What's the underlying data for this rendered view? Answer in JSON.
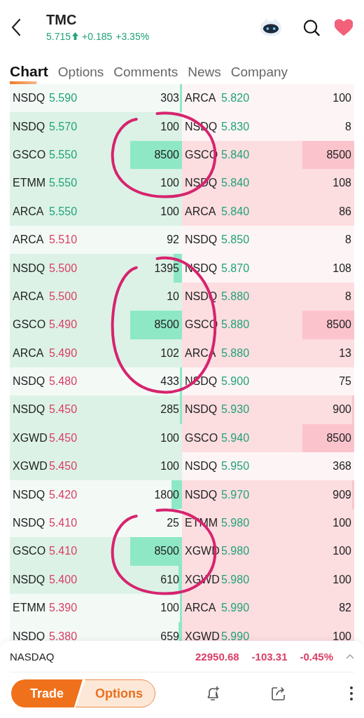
{
  "header": {
    "symbol": "TMC",
    "price": "5.715",
    "change": "+0.185",
    "percent": "+3.35%",
    "up": true,
    "favorite": true
  },
  "tabs": [
    {
      "label": "Chart",
      "selected": true
    },
    {
      "label": "Options",
      "selected": false
    },
    {
      "label": "Comments",
      "selected": false
    },
    {
      "label": "News",
      "selected": false
    },
    {
      "label": "Company",
      "selected": false
    }
  ],
  "order_book": {
    "rows": [
      {
        "circled": false,
        "bid": {
          "venue": "NSDQ",
          "price": "5.590",
          "size": "303",
          "up": true,
          "shaded": false,
          "level": 0.004
        },
        "ask": {
          "venue": "ARCA",
          "price": "5.820",
          "size": "100",
          "up": true,
          "shaded": false
        }
      },
      {
        "circled": true,
        "bid": {
          "venue": "NSDQ",
          "price": "5.570",
          "size": "100",
          "up": true,
          "shaded": true
        },
        "ask": {
          "venue": "NSDQ",
          "price": "5.830",
          "size": "8",
          "up": true,
          "shaded": false
        }
      },
      {
        "circled": true,
        "bid": {
          "venue": "GSCO",
          "price": "5.550",
          "size": "8500",
          "up": true,
          "shaded": true,
          "level": 0.3
        },
        "ask": {
          "venue": "GSCO",
          "price": "5.840",
          "size": "8500",
          "up": true,
          "shaded": true,
          "level": 0.3
        }
      },
      {
        "circled": true,
        "bid": {
          "venue": "ETMM",
          "price": "5.550",
          "size": "100",
          "up": true,
          "shaded": true
        },
        "ask": {
          "venue": "NSDQ",
          "price": "5.840",
          "size": "108",
          "up": true,
          "shaded": true
        }
      },
      {
        "circled": false,
        "bid": {
          "venue": "ARCA",
          "price": "5.550",
          "size": "100",
          "up": true,
          "shaded": true
        },
        "ask": {
          "venue": "ARCA",
          "price": "5.840",
          "size": "86",
          "up": true,
          "shaded": true
        }
      },
      {
        "circled": false,
        "bid": {
          "venue": "ARCA",
          "price": "5.510",
          "size": "92",
          "up": false,
          "shaded": false
        },
        "ask": {
          "venue": "NSDQ",
          "price": "5.850",
          "size": "8",
          "up": true,
          "shaded": false
        }
      },
      {
        "circled": true,
        "bid": {
          "venue": "NSDQ",
          "price": "5.500",
          "size": "1395",
          "up": false,
          "shaded": true,
          "level": 0.05
        },
        "ask": {
          "venue": "NSDQ",
          "price": "5.870",
          "size": "108",
          "up": true,
          "shaded": false
        }
      },
      {
        "circled": true,
        "bid": {
          "venue": "ARCA",
          "price": "5.500",
          "size": "10",
          "up": false,
          "shaded": true
        },
        "ask": {
          "venue": "NSDQ",
          "price": "5.880",
          "size": "8",
          "up": true,
          "shaded": true
        }
      },
      {
        "circled": true,
        "bid": {
          "venue": "GSCO",
          "price": "5.490",
          "size": "8500",
          "up": false,
          "shaded": true,
          "level": 0.3
        },
        "ask": {
          "venue": "GSCO",
          "price": "5.880",
          "size": "8500",
          "up": true,
          "shaded": true,
          "level": 0.3
        }
      },
      {
        "circled": true,
        "bid": {
          "venue": "ARCA",
          "price": "5.490",
          "size": "102",
          "up": false,
          "shaded": true
        },
        "ask": {
          "venue": "ARCA",
          "price": "5.880",
          "size": "13",
          "up": true,
          "shaded": true
        }
      },
      {
        "circled": true,
        "bid": {
          "venue": "NSDQ",
          "price": "5.480",
          "size": "433",
          "up": false,
          "shaded": false,
          "level": 0.008
        },
        "ask": {
          "venue": "NSDQ",
          "price": "5.900",
          "size": "75",
          "up": true,
          "shaded": false
        }
      },
      {
        "circled": false,
        "bid": {
          "venue": "NSDQ",
          "price": "5.450",
          "size": "285",
          "up": false,
          "shaded": true,
          "level": 0.004
        },
        "ask": {
          "venue": "NSDQ",
          "price": "5.930",
          "size": "900",
          "up": true,
          "shaded": true,
          "level": 0.004
        }
      },
      {
        "circled": false,
        "bid": {
          "venue": "XGWD",
          "price": "5.450",
          "size": "100",
          "up": false,
          "shaded": true
        },
        "ask": {
          "venue": "GSCO",
          "price": "5.940",
          "size": "8500",
          "up": true,
          "shaded": true,
          "level": 0.3
        }
      },
      {
        "circled": false,
        "bid": {
          "venue": "XGWD",
          "price": "5.450",
          "size": "100",
          "up": false,
          "shaded": true
        },
        "ask": {
          "venue": "NSDQ",
          "price": "5.950",
          "size": "368",
          "up": true,
          "shaded": false
        }
      },
      {
        "circled": false,
        "bid": {
          "venue": "NSDQ",
          "price": "5.420",
          "size": "1800",
          "up": false,
          "shaded": false,
          "level": 0.06
        },
        "ask": {
          "venue": "NSDQ",
          "price": "5.970",
          "size": "909",
          "up": true,
          "shaded": true,
          "level": 0.004
        }
      },
      {
        "circled": true,
        "bid": {
          "venue": "NSDQ",
          "price": "5.410",
          "size": "25",
          "up": false,
          "shaded": false
        },
        "ask": {
          "venue": "ETMM",
          "price": "5.980",
          "size": "100",
          "up": true,
          "shaded": true
        }
      },
      {
        "circled": true,
        "bid": {
          "venue": "GSCO",
          "price": "5.410",
          "size": "8500",
          "up": false,
          "shaded": true,
          "level": 0.3
        },
        "ask": {
          "venue": "XGWD",
          "price": "5.980",
          "size": "100",
          "up": true,
          "shaded": true
        }
      },
      {
        "circled": true,
        "bid": {
          "venue": "NSDQ",
          "price": "5.400",
          "size": "610",
          "up": false,
          "shaded": true,
          "level": 0.02
        },
        "ask": {
          "venue": "XGWD",
          "price": "5.980",
          "size": "100",
          "up": true,
          "shaded": true
        }
      },
      {
        "circled": false,
        "bid": {
          "venue": "ETMM",
          "price": "5.390",
          "size": "100",
          "up": false,
          "shaded": false,
          "level": 0.004
        },
        "ask": {
          "venue": "ARCA",
          "price": "5.990",
          "size": "82",
          "up": true,
          "shaded": true
        }
      },
      {
        "circled": false,
        "bid": {
          "venue": "NSDQ",
          "price": "5.380",
          "size": "659",
          "up": false,
          "shaded": false,
          "level": 0.02
        },
        "ask": {
          "venue": "XGWD",
          "price": "5.990",
          "size": "100",
          "up": true,
          "shaded": true
        }
      }
    ]
  },
  "index_bar": {
    "name": "NASDAQ",
    "value": "22950.68",
    "change": "-103.31",
    "percent": "-0.45%",
    "up": false
  },
  "actions": {
    "trade": "Trade",
    "options": "Options"
  }
}
